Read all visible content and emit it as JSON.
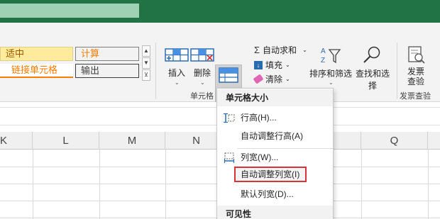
{
  "styles": {
    "neutral": "适中",
    "calculation": "计算",
    "hyperlink": "链接单元格",
    "output": "输出"
  },
  "cells_group": {
    "insert": "插入",
    "delete": "删除",
    "format": "格式",
    "group_label": "单元格"
  },
  "editing": {
    "autosum": "自动求和",
    "fill": "填充",
    "clear": "清除",
    "sort_filter": "排序和筛选",
    "find_select": "查找和选择"
  },
  "invoice": {
    "check_label": "发票\n查验",
    "group_label": "发票查验"
  },
  "columns": [
    "K",
    "L",
    "M",
    "N",
    "Q"
  ],
  "menu": {
    "section_size": "单元格大小",
    "row_height": "行高(H)...",
    "autofit_row": "自动调整行高(A)",
    "column_width": "列宽(W)...",
    "autofit_column": "自动调整列宽(I)",
    "default_width": "默认列宽(D)...",
    "section_visibility": "可见性"
  },
  "colors": {
    "title_bar": "#217346",
    "neutral_fill": "#ffeb9c",
    "calc_fill": "#f2f2f2",
    "calc_text": "#fa7d00",
    "link_text": "#fa7d00",
    "highlight_border": "#d9333a"
  }
}
